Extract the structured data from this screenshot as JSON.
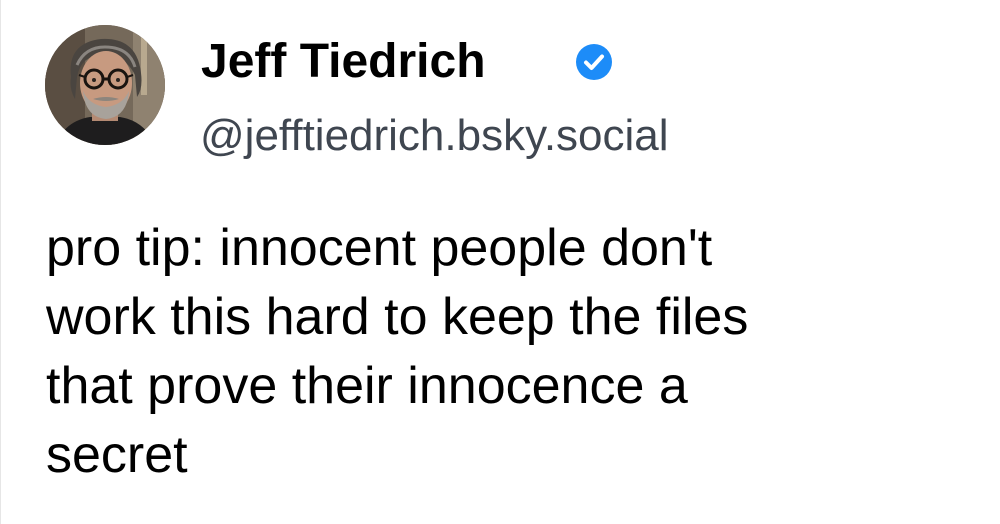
{
  "author": {
    "display_name": "Jeff Tiedrich",
    "handle": "@jefftiedrich.bsky.social",
    "verified": true,
    "avatar_icon": "profile-photo-man-glasses-beard"
  },
  "post": {
    "text": "pro tip: innocent people don't\nwork this hard to keep the files\nthat prove their innocence a\nsecret"
  },
  "colors": {
    "verified_badge": "#1d8cf8",
    "handle_text": "#3f4650",
    "background": "#ffffff"
  }
}
